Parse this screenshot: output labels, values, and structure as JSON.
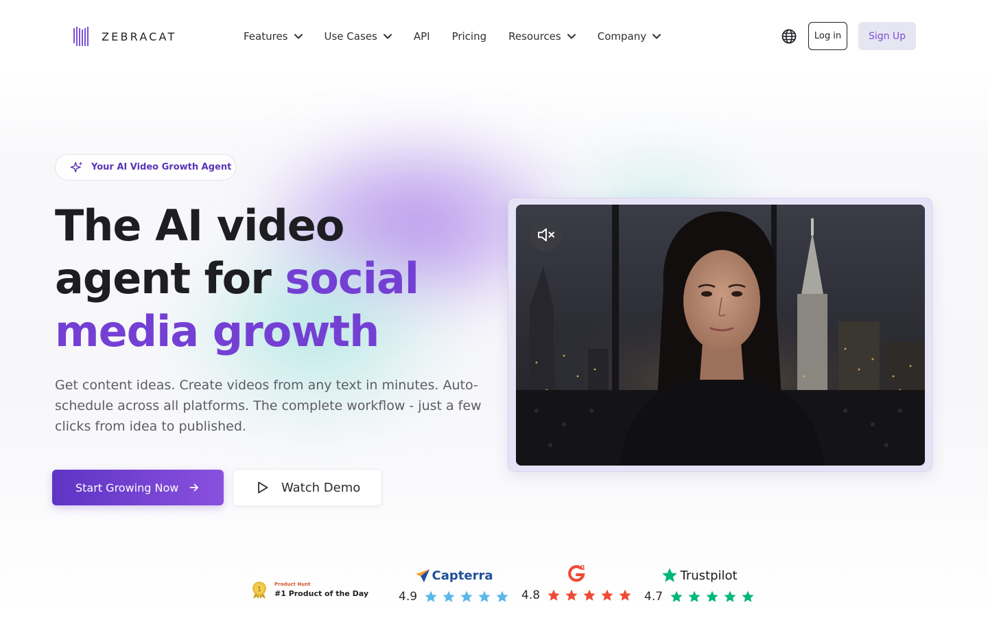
{
  "brand": {
    "name": "ZEBRACAT"
  },
  "nav": {
    "items": [
      {
        "label": "Features",
        "dropdown": true
      },
      {
        "label": "Use Cases",
        "dropdown": true
      },
      {
        "label": "API",
        "dropdown": false
      },
      {
        "label": "Pricing",
        "dropdown": false
      },
      {
        "label": "Resources",
        "dropdown": true
      },
      {
        "label": "Company",
        "dropdown": true
      }
    ],
    "login_label": "Log in",
    "signup_label": "Sign Up"
  },
  "hero": {
    "badge_label": "Your AI Video Growth Agent",
    "headline_part1": "The AI video",
    "headline_part2": "agent for",
    "headline_accent1": "social",
    "headline_accent2": "media growth",
    "subtitle": "Get content ideas. Create videos from any text in minutes. Auto-schedule across all platforms. The complete workflow - just a few clicks from idea to published.",
    "cta_primary": "Start Growing Now",
    "cta_secondary": "Watch Demo"
  },
  "video": {
    "muted": true
  },
  "ratings": {
    "product_hunt": {
      "small_label": "Product Hunt",
      "label": "#1 Product of the Day",
      "rank": "1"
    },
    "capterra": {
      "name": "Capterra",
      "score": "4.9",
      "stars": 5,
      "color": "#5bb8e8"
    },
    "g2": {
      "score": "4.8",
      "stars": 5,
      "color": "#ef4a36"
    },
    "trustpilot": {
      "name": "Trustpilot",
      "score": "4.7",
      "stars": 5,
      "color": "#00b67a"
    }
  },
  "colors": {
    "accent": "#7440d4",
    "primary_button_start": "#5e34c4",
    "primary_button_end": "#8a50de"
  }
}
